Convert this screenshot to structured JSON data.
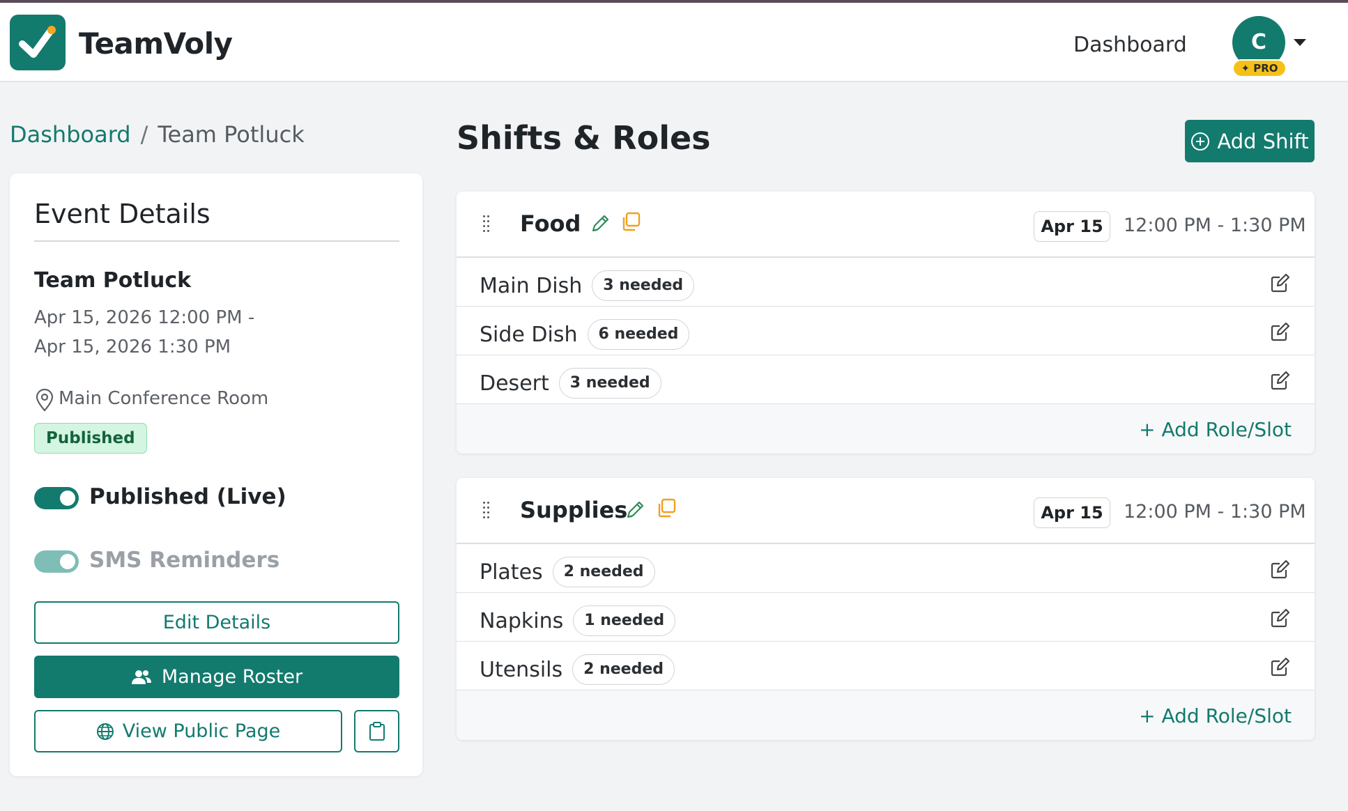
{
  "app": {
    "name": "TeamVoly",
    "logo_icon": "check-square-icon",
    "accent": "#137a6e"
  },
  "nav": {
    "dashboard_label": "Dashboard",
    "avatar_initial": "C",
    "pro_label": "PRO"
  },
  "breadcrumb": {
    "home": "Dashboard",
    "separator": "/",
    "current": "Team Potluck"
  },
  "event": {
    "card_title": "Event Details",
    "name": "Team Potluck",
    "start": "Apr 15, 2026 12:00 PM -",
    "end": "Apr 15, 2026 1:30 PM",
    "location": "Main Conference Room",
    "status_badge": "Published",
    "published_toggle_label": "Published (Live)",
    "published_toggle_on": true,
    "sms_toggle_label": "SMS Reminders",
    "sms_toggle_on": true,
    "edit_label": "Edit Details",
    "roster_label": "Manage Roster",
    "view_public_label": "View Public Page"
  },
  "main": {
    "title": "Shifts & Roles",
    "add_shift_label": "Add Shift"
  },
  "shifts": [
    {
      "name": "Food",
      "date": "Apr 15",
      "time": "12:00 PM - 1:30 PM",
      "roles": [
        {
          "name": "Main Dish",
          "needed": "3 needed"
        },
        {
          "name": "Side Dish",
          "needed": "6 needed"
        },
        {
          "name": "Desert",
          "needed": "3 needed"
        }
      ],
      "add_role_label": "+ Add Role/Slot"
    },
    {
      "name": "Supplies",
      "date": "Apr 15",
      "time": "12:00 PM - 1:30 PM",
      "roles": [
        {
          "name": "Plates",
          "needed": "2 needed"
        },
        {
          "name": "Napkins",
          "needed": "1 needed"
        },
        {
          "name": "Utensils",
          "needed": "2 needed"
        }
      ],
      "add_role_label": "+ Add Role/Slot"
    }
  ]
}
